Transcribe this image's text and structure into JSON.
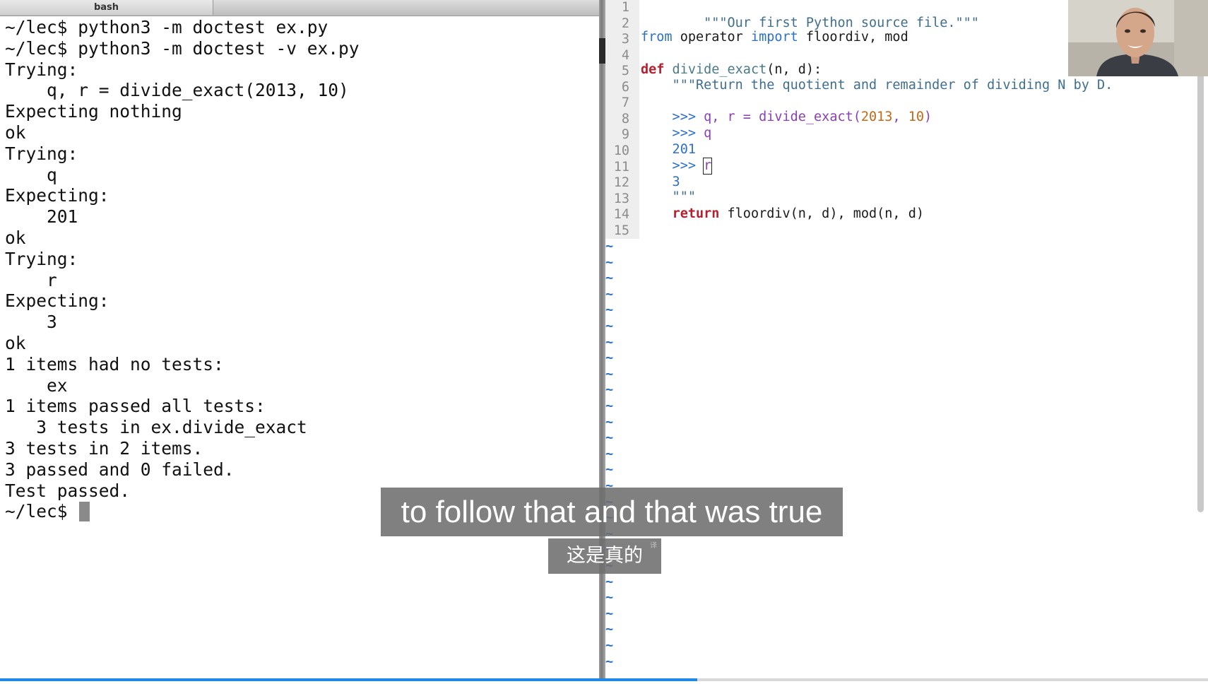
{
  "terminal": {
    "tab_label": "bash",
    "lines": [
      "~/lec$ python3 -m doctest ex.py",
      "~/lec$ python3 -m doctest -v ex.py",
      "Trying:",
      "    q, r = divide_exact(2013, 10)",
      "Expecting nothing",
      "ok",
      "Trying:",
      "    q",
      "Expecting:",
      "    201",
      "ok",
      "Trying:",
      "    r",
      "Expecting:",
      "    3",
      "ok",
      "1 items had no tests:",
      "    ex",
      "1 items passed all tests:",
      "   3 tests in ex.divide_exact",
      "3 tests in 2 items.",
      "3 passed and 0 failed.",
      "Test passed."
    ],
    "prompt": "~/lec$"
  },
  "editor": {
    "line_numbers": [
      "1",
      "2",
      "3",
      "4",
      "5",
      "6",
      "7",
      "8",
      "9",
      "10",
      "11",
      "12",
      "13",
      "14",
      "15"
    ],
    "tilde": "~",
    "code": {
      "l1": "\"\"\"Our first Python source file.\"\"\"",
      "l3_from": "from",
      "l3_operator": " operator ",
      "l3_import": "import",
      "l3_rest": " floordiv, mod",
      "l5_def": "def",
      "l5_name": " divide_exact",
      "l5_rest": "(n, d):",
      "l6": "    \"\"\"Return the quotient and remainder of dividing N by D.",
      "l8_prompt": "    >>> ",
      "l8_code": "q, r = divide_exact(",
      "l8_n1": "2013",
      "l8_sep": ", ",
      "l8_n2": "10",
      "l8_close": ")",
      "l9_prompt": "    >>> ",
      "l9_code": "q",
      "l10": "    201",
      "l11_prompt": "    >>> ",
      "l11_code": "r",
      "l12": "    3",
      "l13": "    \"\"\"",
      "l14_indent": "    ",
      "l14_return": "return",
      "l14_rest": " floordiv(n, d), mod(n, d)"
    }
  },
  "video": {
    "subtitle_en": "to follow that and that was true",
    "subtitle_zh": "这是真的",
    "subtitle_zh_mark": "译",
    "progress": 0.577
  },
  "colors": {
    "keyword": "#2c6fcc",
    "def_return": "#b4202f",
    "docstring": "#3f6e8f",
    "number": "#c06a18",
    "progress": "#1e88e5"
  }
}
